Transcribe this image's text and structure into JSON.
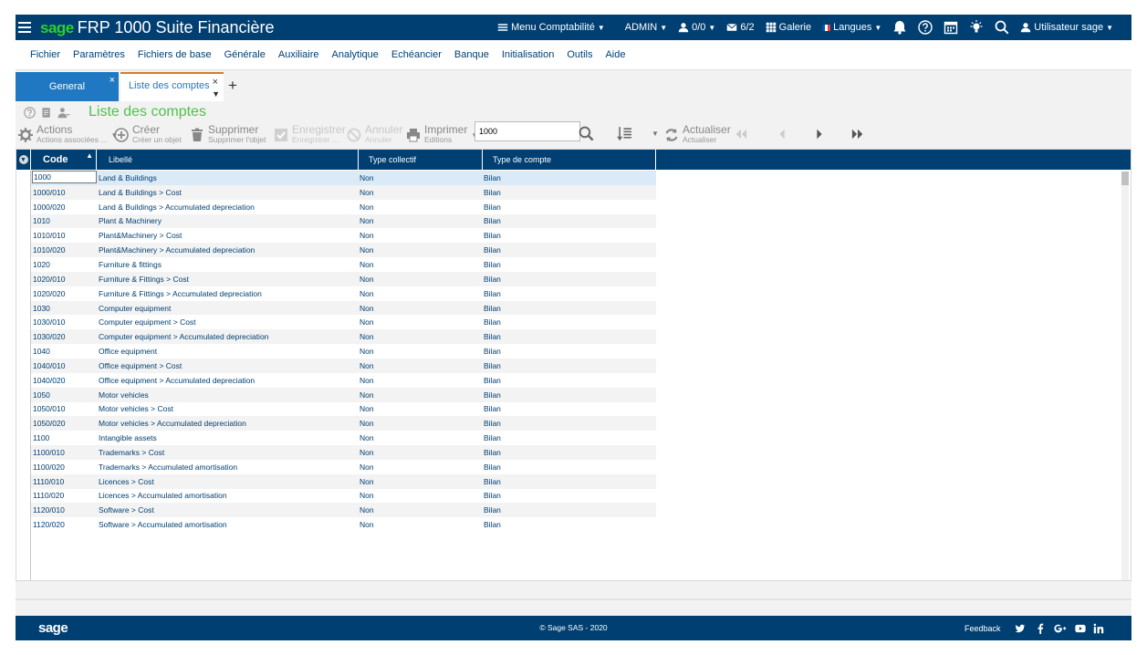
{
  "app": {
    "brand_logo": "sage",
    "title": "FRP 1000 Suite Financière"
  },
  "topbar": {
    "menu_label": "Menu Comptabilité",
    "admin_label": "ADMIN",
    "users_count": "0/0",
    "messages_count": "6/2",
    "gallery_label": "Galerie",
    "languages_label": "Langues",
    "user_label": "Utilisateur sage"
  },
  "menubar": {
    "items": [
      "Fichier",
      "Paramètres",
      "Fichiers de base",
      "Générale",
      "Auxiliaire",
      "Analytique",
      "Echéancier",
      "Banque",
      "Initialisation",
      "Outils",
      "Aide"
    ]
  },
  "tabs": {
    "general_label": "General",
    "list_label": "Liste des comptes",
    "close_glyph": "×",
    "add_glyph": "+"
  },
  "page": {
    "title": "Liste des comptes"
  },
  "toolbar": {
    "actions_main": "Actions",
    "actions_sub": "Actions associées ...",
    "creer_main": "Créer",
    "creer_sub": "Créer un objet",
    "supprimer_main": "Supprimer",
    "supprimer_sub": "Supprimer l'objet",
    "enregistrer_main": "Enregistrer",
    "enregistrer_sub": "Enregistrer ...",
    "annuler_main": "Annuler",
    "annuler_sub": "Annuler",
    "imprimer_main": "Imprimer",
    "imprimer_sub": "Editions",
    "search_value": "1000",
    "actualiser_main": "Actualiser",
    "actualiser_sub": "Actualiser"
  },
  "grid": {
    "columns": {
      "code": "Code",
      "libelle": "Libellé",
      "type_collectif": "Type collectif",
      "type_compte": "Type de compte"
    },
    "rows": [
      {
        "code": "1000",
        "libelle": "Land & Buildings",
        "collectif": "Non",
        "type": "Bilan"
      },
      {
        "code": "1000/010",
        "libelle": "Land & Buildings > Cost",
        "collectif": "Non",
        "type": "Bilan"
      },
      {
        "code": "1000/020",
        "libelle": "Land & Buildings > Accumulated depreciation",
        "collectif": "Non",
        "type": "Bilan"
      },
      {
        "code": "1010",
        "libelle": "Plant & Machinery",
        "collectif": "Non",
        "type": "Bilan"
      },
      {
        "code": "1010/010",
        "libelle": "Plant&Machinery > Cost",
        "collectif": "Non",
        "type": "Bilan"
      },
      {
        "code": "1010/020",
        "libelle": "Plant&Machinery > Accumulated depreciation",
        "collectif": "Non",
        "type": "Bilan"
      },
      {
        "code": "1020",
        "libelle": "Furniture & fittings",
        "collectif": "Non",
        "type": "Bilan"
      },
      {
        "code": "1020/010",
        "libelle": "Furniture & Fittings > Cost",
        "collectif": "Non",
        "type": "Bilan"
      },
      {
        "code": "1020/020",
        "libelle": "Furniture & Fittings > Accumulated depreciation",
        "collectif": "Non",
        "type": "Bilan"
      },
      {
        "code": "1030",
        "libelle": "Computer equipment",
        "collectif": "Non",
        "type": "Bilan"
      },
      {
        "code": "1030/010",
        "libelle": "Computer equipment > Cost",
        "collectif": "Non",
        "type": "Bilan"
      },
      {
        "code": "1030/020",
        "libelle": "Computer equipment > Accumulated depreciation",
        "collectif": "Non",
        "type": "Bilan"
      },
      {
        "code": "1040",
        "libelle": "Office equipment",
        "collectif": "Non",
        "type": "Bilan"
      },
      {
        "code": "1040/010",
        "libelle": "Office equipment > Cost",
        "collectif": "Non",
        "type": "Bilan"
      },
      {
        "code": "1040/020",
        "libelle": "Office equipment > Accumulated depreciation",
        "collectif": "Non",
        "type": "Bilan"
      },
      {
        "code": "1050",
        "libelle": "Motor vehicles",
        "collectif": "Non",
        "type": "Bilan"
      },
      {
        "code": "1050/010",
        "libelle": "Motor vehicles > Cost",
        "collectif": "Non",
        "type": "Bilan"
      },
      {
        "code": "1050/020",
        "libelle": "Motor vehicles > Accumulated depreciation",
        "collectif": "Non",
        "type": "Bilan"
      },
      {
        "code": "1100",
        "libelle": "Intangible assets",
        "collectif": "Non",
        "type": "Bilan"
      },
      {
        "code": "1100/010",
        "libelle": "Trademarks > Cost",
        "collectif": "Non",
        "type": "Bilan"
      },
      {
        "code": "1100/020",
        "libelle": "Trademarks > Accumulated amortisation",
        "collectif": "Non",
        "type": "Bilan"
      },
      {
        "code": "1110/010",
        "libelle": "Licences > Cost",
        "collectif": "Non",
        "type": "Bilan"
      },
      {
        "code": "1110/020",
        "libelle": "Licences > Accumulated amortisation",
        "collectif": "Non",
        "type": "Bilan"
      },
      {
        "code": "1120/010",
        "libelle": "Software > Cost",
        "collectif": "Non",
        "type": "Bilan"
      },
      {
        "code": "1120/020",
        "libelle": "Software > Accumulated amortisation",
        "collectif": "Non",
        "type": "Bilan"
      }
    ]
  },
  "footer": {
    "logo": "sage",
    "copyright": "© Sage SAS - 2020",
    "feedback": "Feedback"
  },
  "colors": {
    "navy": "#003f72",
    "brand_green": "#2bd22b",
    "title_green": "#4cc34c",
    "tab_blue": "#1f78c1",
    "tab_accent": "#d97b2a"
  }
}
